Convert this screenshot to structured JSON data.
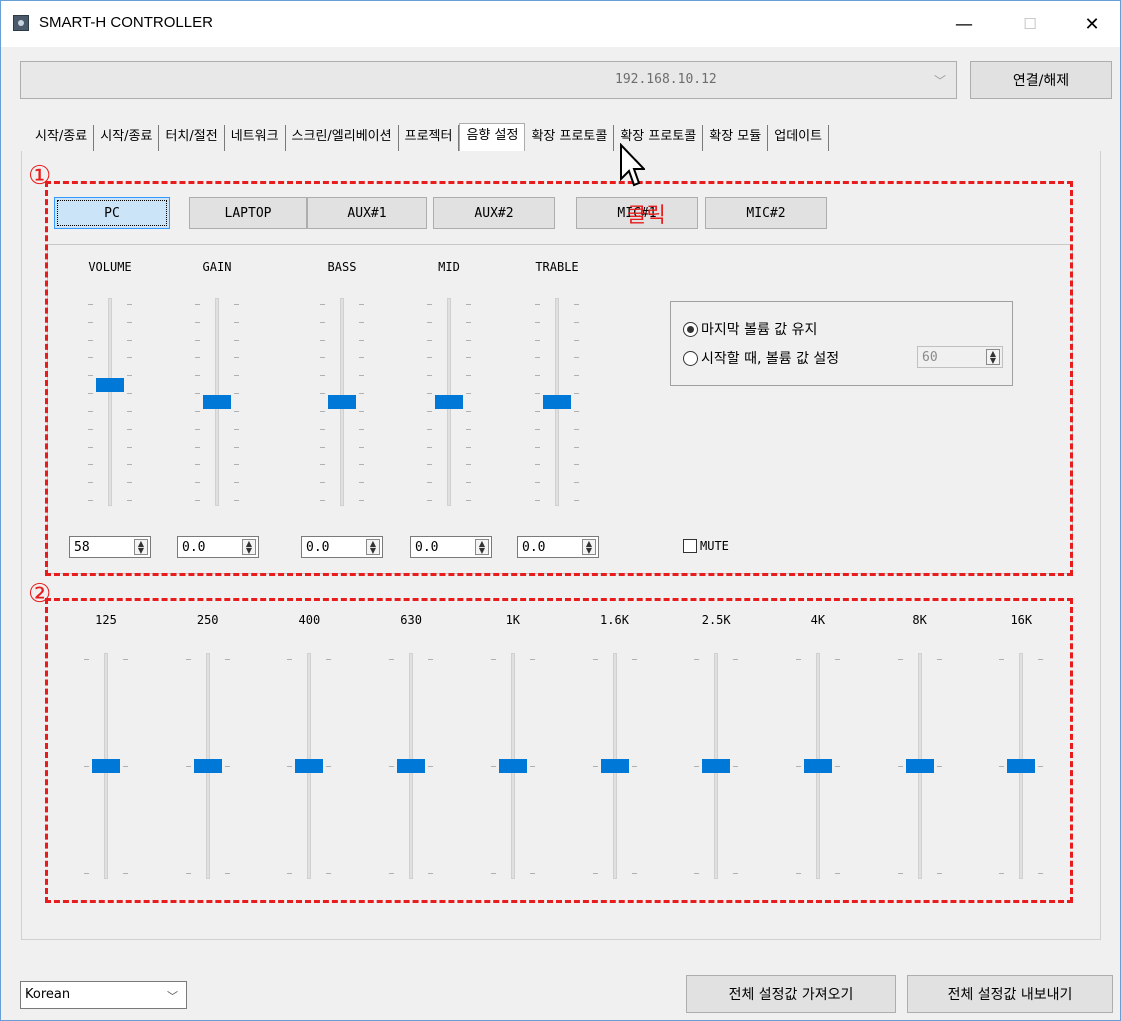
{
  "window": {
    "title": "SMART-H CONTROLLER",
    "minimize": "—",
    "maximize": "☐",
    "close": "✕"
  },
  "connection": {
    "address": "192.168.10.12",
    "connect_label": "연결/해제"
  },
  "tabs": [
    "시작/종료",
    "시작/종료",
    "터치/절전",
    "네트워크",
    "스크린/엘리베이션",
    "프로젝터",
    "음향 설정",
    "확장 프로토콜",
    "확장 프로토콜",
    "확장 모듈",
    "업데이트"
  ],
  "active_tab_index": 6,
  "sources": [
    "PC",
    "LAPTOP",
    "AUX#1",
    "AUX#2",
    "MIC#1",
    "MIC#2"
  ],
  "selected_source": "PC",
  "mixer": {
    "labels": [
      "VOLUME",
      "GAIN",
      "BASS",
      "MID",
      "TRABLE"
    ],
    "values": [
      "58",
      "0.0",
      "0.0",
      "0.0",
      "0.0"
    ],
    "levels": [
      0.58,
      0.5,
      0.5,
      0.5,
      0.5
    ]
  },
  "volume_options": {
    "keep_last": "마지막 볼륨 값 유지",
    "set_on_start": "시작할 때, 볼륨 값 설정",
    "start_value": "60",
    "selected": "keep_last"
  },
  "mute_label": "MUTE",
  "equalizer": {
    "bands": [
      "125",
      "250",
      "400",
      "630",
      "1K",
      "1.6K",
      "2.5K",
      "4K",
      "8K",
      "16K"
    ],
    "levels": [
      0.5,
      0.5,
      0.5,
      0.5,
      0.5,
      0.5,
      0.5,
      0.5,
      0.5,
      0.5
    ]
  },
  "annotations": {
    "marker1": "①",
    "marker2": "②",
    "click_label": "클릭"
  },
  "footer": {
    "language": "Korean",
    "import_label": "전체 설정값 가져오기",
    "export_label": "전체 설정값 내보내기"
  },
  "colors": {
    "thumb": "#0078d7",
    "annotation": "#e81c1c",
    "selected_button": "#cce4f7"
  }
}
